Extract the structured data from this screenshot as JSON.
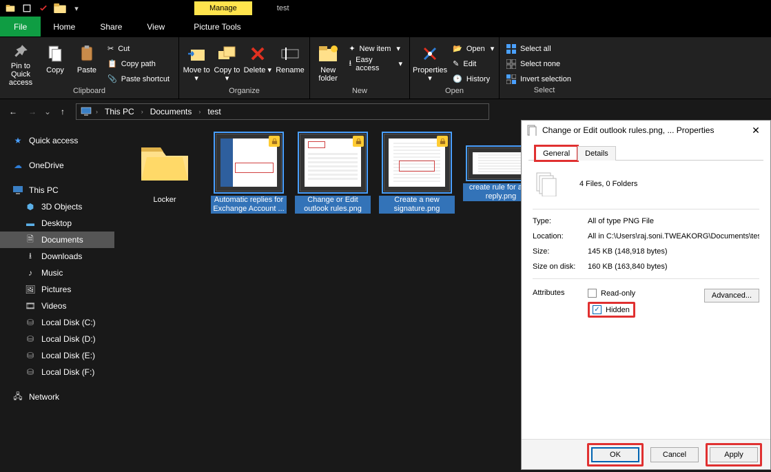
{
  "window": {
    "title": "test"
  },
  "contextual_tab": "Manage",
  "tabs": {
    "file": "File",
    "home": "Home",
    "share": "Share",
    "view": "View",
    "picture": "Picture Tools"
  },
  "ribbon": {
    "clipboard": {
      "label": "Clipboard",
      "pin": "Pin to Quick access",
      "copy": "Copy",
      "paste": "Paste",
      "cut": "Cut",
      "copy_path": "Copy path",
      "paste_shortcut": "Paste shortcut"
    },
    "organize": {
      "label": "Organize",
      "move_to": "Move to",
      "copy_to": "Copy to",
      "delete": "Delete",
      "rename": "Rename"
    },
    "new": {
      "label": "New",
      "new_folder": "New folder",
      "new_item": "New item",
      "easy_access": "Easy access"
    },
    "open": {
      "label": "Open",
      "properties": "Properties",
      "open": "Open",
      "edit": "Edit",
      "history": "History"
    },
    "select": {
      "label": "Select",
      "select_all": "Select all",
      "select_none": "Select none",
      "invert": "Invert selection"
    }
  },
  "breadcrumbs": {
    "a": "This PC",
    "b": "Documents",
    "c": "test"
  },
  "sidebar": {
    "quick": "Quick access",
    "onedrive": "OneDrive",
    "thispc": "This PC",
    "objects3d": "3D Objects",
    "desktop": "Desktop",
    "documents": "Documents",
    "downloads": "Downloads",
    "music": "Music",
    "pictures": "Pictures",
    "videos": "Videos",
    "diskc": "Local Disk (C:)",
    "diskd": "Local Disk (D:)",
    "diske": "Local Disk (E:)",
    "diskf": "Local Disk (F:)",
    "network": "Network"
  },
  "files": {
    "f0": "Locker",
    "f1": "Automatic replies for Exchange Account ...",
    "f2": "Change or Edit outlook rules.png",
    "f3": "Create a new signature.png",
    "f4": "create rule for auto reply.png"
  },
  "dialog": {
    "title": "Change or Edit outlook rules.png, ... Properties",
    "tab_general": "General",
    "tab_details": "Details",
    "summary": "4 Files, 0 Folders",
    "type_k": "Type:",
    "type_v": "All of type PNG File",
    "loc_k": "Location:",
    "loc_v": "All in C:\\Users\\raj.soni.TWEAKORG\\Documents\\tes",
    "size_k": "Size:",
    "size_v": "145 KB (148,918 bytes)",
    "disk_k": "Size on disk:",
    "disk_v": "160 KB (163,840 bytes)",
    "attr_k": "Attributes",
    "readonly": "Read-only",
    "hidden": "Hidden",
    "advanced": "Advanced...",
    "ok": "OK",
    "cancel": "Cancel",
    "apply": "Apply"
  }
}
